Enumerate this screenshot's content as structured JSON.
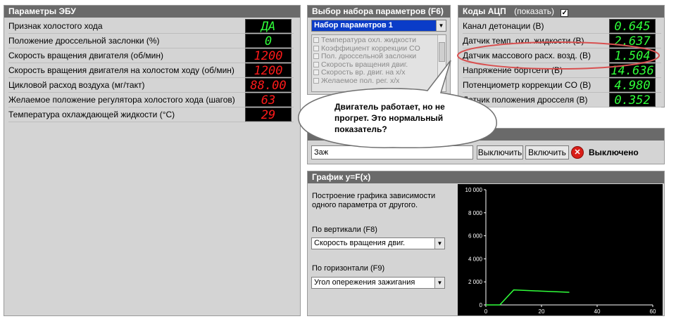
{
  "ecu_panel": {
    "title": "Параметры ЭБУ",
    "rows": [
      {
        "label": "Признак холостого хода",
        "value": "ДА",
        "color": "green"
      },
      {
        "label": "Положение дроссельной заслонки (%)",
        "value": "0",
        "color": "green"
      },
      {
        "label": "Скорость вращения двигателя (об/мин)",
        "value": "1200",
        "color": "red"
      },
      {
        "label": "Скорость вращения двигателя на холостом ходу (об/мин)",
        "value": "1200",
        "color": "red"
      },
      {
        "label": "Цикловой расход воздуха (мг/такт)",
        "value": "88.00",
        "color": "red"
      },
      {
        "label": "Желаемое положение регулятора холостого хода (шагов)",
        "value": "63",
        "color": "red"
      },
      {
        "label": "Температура охлаждающей жидкости (°C)",
        "value": "29",
        "color": "red"
      }
    ]
  },
  "param_set": {
    "title": "Выбор набора параметров (F6)",
    "selected": "Набор параметров 1",
    "items": [
      "Температура охл. жидкости",
      "Коэффициент коррекции CO",
      "Пол. дроссельной заслонки",
      "Скорость вращения двиг.",
      "Скорость вр. двиг. на х/х",
      "Желаемое пол. рег. х/х"
    ]
  },
  "adc_panel": {
    "title": "Коды АЦП",
    "show_label": "(показать)",
    "show_checked": true,
    "rows": [
      {
        "label": "Канал детонации (В)",
        "value": "0.645"
      },
      {
        "label": "Датчик темп. охл. жидкости (В)",
        "value": "2.637"
      },
      {
        "label": "Датчик массового расх. возд. (В)",
        "value": "1.504"
      },
      {
        "label": "Напряжение бортсети (В)",
        "value": "14.636"
      },
      {
        "label": "Потенциометр коррекции CO (В)",
        "value": "4.980"
      },
      {
        "label": "Датчик положения дросселя (В)",
        "value": "0.352"
      }
    ]
  },
  "control_panel": {
    "select_value": "Заж",
    "off_button": "Выключить",
    "on_button": "Включить",
    "status": "Выключено"
  },
  "graph_panel": {
    "title": "График y=F(x)",
    "description_line1": "Построение графика зависимости",
    "description_line2": "одного параметра от другого.",
    "vertical_label": "По вертикали (F8)",
    "vertical_value": "Скорость вращения двиг.",
    "horizontal_label": "По горизонтали (F9)",
    "horizontal_value": "Угол опережения зажигания"
  },
  "callout": {
    "line1": "Двигатель работает, но не",
    "line2": "прогрет. Это нормальный",
    "line3": "показатель?"
  },
  "colors": {
    "led_red": "#ff1a1a",
    "led_green": "#30ff3a",
    "highlight_ellipse": "#d85050",
    "plot_line": "#30ff3a"
  },
  "chart_data": {
    "type": "line",
    "title": "",
    "xlabel": "",
    "ylabel": "",
    "xlim": [
      0,
      60
    ],
    "ylim": [
      0,
      10000
    ],
    "x_ticks": [
      0,
      20,
      40,
      60
    ],
    "y_ticks": [
      0,
      2000,
      4000,
      6000,
      8000,
      10000
    ],
    "x_tick_labels": [
      "0",
      "20",
      "40",
      "60"
    ],
    "y_tick_labels": [
      "0",
      "2 000",
      "4 000",
      "6 000",
      "8 000",
      "10 000"
    ],
    "series": [
      {
        "x": [
          0,
          5,
          10,
          20,
          30
        ],
        "y": [
          0,
          0,
          1300,
          1200,
          1100
        ]
      }
    ]
  }
}
